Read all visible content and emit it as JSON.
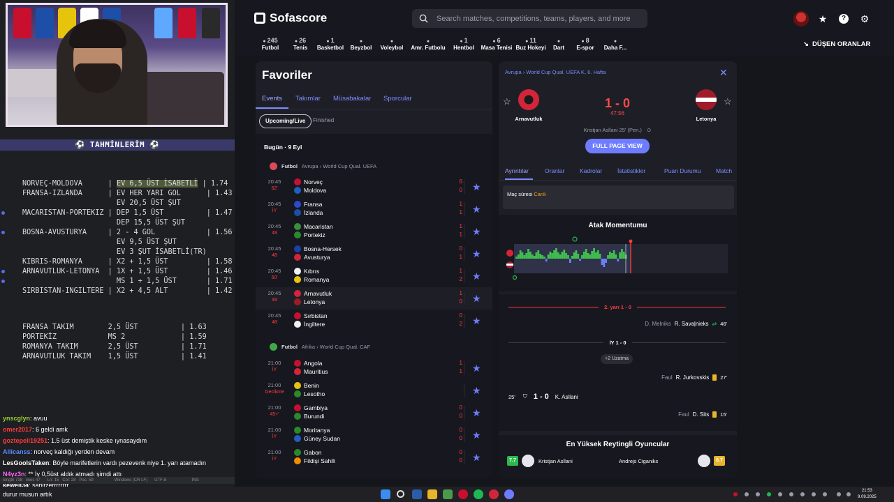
{
  "overlay": {
    "predictions_title": "⚽ TAHMİNLERİM ⚽",
    "predictions": [
      {
        "text": "NORVEÇ-MOLDOVA      | ",
        "hl": "EV 6,5 ÜST İSABETLİ",
        "odd": " | 1.74"
      },
      {
        "text": "FRANSA-IZLANDA      | EV HER YARI GOL      | 1.43"
      },
      {
        "text": "                      EV 20,5 ÜST ŞUT"
      },
      {
        "text": "MACARISTAN-PORTEKIZ | DEP 1,5 ÜST          | 1.47"
      },
      {
        "text": "                      DEP 15,5 ÜST ŞUT"
      },
      {
        "text": "BOSNA-AVUSTURYA     | 2 - 4 GOL            | 1.56"
      },
      {
        "text": "                      EV 9,5 ÜST ŞUT"
      },
      {
        "text": "                      EV 3 ŞUT İSABETLİ(TR)"
      },
      {
        "text": "KIBRIS-ROMANYA      | X2 + 1,5 ÜST         | 1.58"
      },
      {
        "text": "ARNAVUTLUK-LETONYA  | 1X + 1,5 ÜST         | 1.46"
      },
      {
        "text": "                      MS 1 + 1,5 ÜST       | 1.71"
      },
      {
        "text": "SIRBISTAN-INGILTERE | X2 + 4,5 ALT         | 1.42"
      }
    ],
    "predictions2": [
      {
        "text": "FRANSA TAKIM        2,5 ÜST          | 1.63"
      },
      {
        "text": "PORTEKİZ            MS 2             | 1.59"
      },
      {
        "text": "ROMANYA TAKIM       2,5 ÜST          | 1.71"
      },
      {
        "text": "ARNAVUTLUK TAKIM    1,5 ÜST          | 1.41"
      }
    ],
    "chat": [
      {
        "user": "ynscglyn",
        "color": "#9acd32",
        "msg": ": avuu"
      },
      {
        "user": "omer2017",
        "color": "#ff3b3b",
        "msg": ": 6 geldi amk"
      },
      {
        "user": "goztepeli19251",
        "color": "#ff3b3b",
        "msg": ": 1.5 üst demiştik keske ıynasaydım"
      },
      {
        "user": "Allicanss",
        "color": "#5a8aff",
        "msg": ": norveç kaldığı yerden devam"
      },
      {
        "user": "LesGoolsTaken",
        "color": "#ffffff",
        "msg": ": Böyle marifetlerin vardı pezevenk niye 1. yarı atamadın"
      },
      {
        "user": "N4yz3n",
        "color": "#ff66ff",
        "msg": ": ** İy 0,5üst aldık atmadı şimdi attı"
      },
      {
        "user": "kewell34",
        "color": "#ffffff",
        "msg": ": sabitzerrrrrrrr"
      }
    ],
    "statusbar": "length 738   lines 47      Ln: 15   Col: 28   Pos: 59                  Windows (CR LF)      UTF-8                      INS"
  },
  "header": {
    "brand": "Sofascore",
    "search_placeholder": "Search matches, competitions, teams, players, and more",
    "odds_button": "DÜŞEN ORANLAR"
  },
  "sports": [
    {
      "count": "245",
      "label": "Futbol"
    },
    {
      "count": "26",
      "label": "Tenis"
    },
    {
      "count": "1",
      "label": "Basketbol"
    },
    {
      "count": "",
      "label": "Beyzbol"
    },
    {
      "count": "",
      "label": "Voleybol"
    },
    {
      "count": "",
      "label": "Amr. Futbolu"
    },
    {
      "count": "1",
      "label": "Hentbol"
    },
    {
      "count": "6",
      "label": "Masa Tenisi"
    },
    {
      "count": "11",
      "label": "Buz Hokeyi"
    },
    {
      "count": "",
      "label": "Dart"
    },
    {
      "count": "8",
      "label": "E-spor"
    },
    {
      "count": "",
      "label": "Daha F..."
    }
  ],
  "favorites": {
    "title": "Favoriler",
    "tabs": [
      "Events",
      "Takımlar",
      "Müsabakalar",
      "Sporcular"
    ],
    "pills": [
      "Upcoming/Live",
      "Finished"
    ],
    "day": "Bugün · 9 Eyl",
    "competitions": [
      {
        "sport": "Futbol",
        "path": "Avrupa  ›  World Cup Qual. UEFA"
      },
      {
        "sport": "Futbol",
        "path": "Afrika  ›  World Cup Qual. CAF"
      }
    ],
    "matches": [
      {
        "time": "20:45",
        "status": "52'",
        "home": "Norveç",
        "away": "Moldova",
        "hs": "6",
        "as": "0",
        "hc": "#c8102e",
        "ac": "#1f5fbf"
      },
      {
        "time": "20:45",
        "status": "İY",
        "home": "Fransa",
        "away": "İzlanda",
        "hs": "1",
        "as": "1",
        "hc": "#2a4ad1",
        "ac": "#1d4fa8"
      },
      {
        "time": "20:45",
        "status": "48",
        "home": "Macaristan",
        "away": "Portekiz",
        "hs": "1",
        "as": "1",
        "hc": "#3c8c3c",
        "ac": "#2a8a2a"
      },
      {
        "time": "20:45",
        "status": "48",
        "home": "Bosna-Hersek",
        "away": "Avusturya",
        "hs": "0",
        "as": "1",
        "hc": "#1c3fa8",
        "ac": "#d3253a"
      },
      {
        "time": "20:45",
        "status": "50'",
        "home": "Kıbrıs",
        "away": "Romanya",
        "hs": "1",
        "as": "2",
        "hc": "#f0f0f0",
        "ac": "#e6c40c"
      },
      {
        "time": "20:45",
        "status": "48",
        "home": "Arnavutluk",
        "away": "Letonya",
        "hs": "1",
        "as": "0",
        "hc": "#d3253a",
        "ac": "#9e1c2a"
      },
      {
        "time": "20:45",
        "status": "48",
        "home": "Sırbistan",
        "away": "İngiltere",
        "hs": "0",
        "as": "2",
        "hc": "#c8102e",
        "ac": "#f0f0f0"
      },
      {
        "time": "21:00",
        "status": "İY",
        "home": "Angola",
        "away": "Mauritius",
        "hs": "1",
        "as": "1",
        "hc": "#c8102e",
        "ac": "#d3253a"
      },
      {
        "time": "21:00",
        "status": "Gecikme",
        "home": "Benin",
        "away": "Lesotho",
        "hs": "",
        "as": "",
        "hc": "#e6c40c",
        "ac": "#2a8a2a"
      },
      {
        "time": "21:00",
        "status": "45+'",
        "home": "Gambiya",
        "away": "Burundi",
        "hs": "0",
        "as": "0",
        "hc": "#c8102e",
        "ac": "#2a8a2a"
      },
      {
        "time": "21:00",
        "status": "İY",
        "home": "Moritanya",
        "away": "Güney Sudan",
        "hs": "0",
        "as": "0",
        "hc": "#2a8a2a",
        "ac": "#1f5fbf"
      },
      {
        "time": "21:00",
        "status": "İY",
        "home": "Gabon",
        "away": "Fildişi Sahili",
        "hs": "0",
        "as": "0",
        "hc": "#2a8a2a",
        "ac": "#f08c00"
      }
    ]
  },
  "detail": {
    "breadcrumb": "Avrupa  ›  World Cup Qual. UEFA K, 6. Hafta",
    "home": "Arnavutluk",
    "away": "Letonya",
    "score": "1 - 0",
    "clock": "47:56",
    "scorer": "Kristjan Asllani 25' (Pen.)",
    "full_page": "FULL PAGE VIEW",
    "tabs": [
      "Ayrıntılar",
      "Oranlar",
      "Kadrolar",
      "İstatistikler",
      "Puan Durumu",
      "Match"
    ],
    "match_time_label": "Maç süresi",
    "match_time_value": "Canlı",
    "momentum_title": "Atak Momentumu",
    "second_half": "2. yarı 1 - 0",
    "first_half": "İY 1 - 0",
    "extra": "+2 Uzatma",
    "events": [
      {
        "minute": "46'",
        "player_in": "R. Savaļnieks",
        "player_out": "D. Melniks"
      },
      {
        "minute": "27'",
        "player": "R. Jurkovskis",
        "type": "Faul"
      },
      {
        "minute": "25'",
        "player": "K. Asllani",
        "score": "1 - 0"
      },
      {
        "minute": "15'",
        "player": "D. Sits",
        "type": "Faul"
      }
    ],
    "ratings_title": "En Yüksek Reytingli Oyuncular",
    "ratings": [
      {
        "name": "Kristjan Asllani",
        "rating": "7.7",
        "color": "#2db84d"
      },
      {
        "name": "Andrejs Ciganiks",
        "rating": "6.7",
        "color": "#e8b52a"
      }
    ]
  },
  "taskbar": {
    "chat_tail": "durur musun artık",
    "time": "21:53",
    "date": "9.09.2025"
  }
}
